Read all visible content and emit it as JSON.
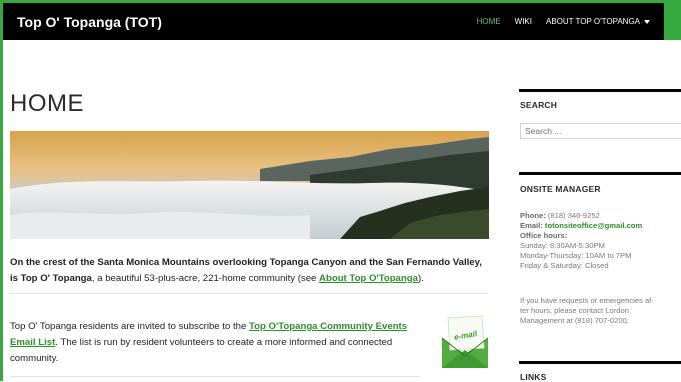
{
  "header": {
    "site_title": "Top O' Topanga (TOT)",
    "nav": [
      {
        "label": "HOME",
        "active": true
      },
      {
        "label": "WIKI",
        "active": false
      },
      {
        "label": "ABOUT TOP O'TOPANGA",
        "active": false,
        "has_dropdown": true
      }
    ]
  },
  "main": {
    "page_title": "HOME",
    "hero_image_icon": "landscape-photo",
    "intro": {
      "bold_text": "On the crest of the Santa Monica Mountains overlooking Topanga Canyon and the San Fernando Valley, is Top O' Topanga",
      "text": ", a beautiful 53-plus-acre, 221-home community (see ",
      "link": "About Top O'Topanga",
      "tail": ")."
    },
    "promo": {
      "text": "Top O' Topanga residents are invited to subscribe to the ",
      "link": "Top O'Topanga Community Events Email List",
      "tail": ". The list is run by resident volunteers to create a more informed and connected community."
    },
    "email_icon_label": "e-mail"
  },
  "sidebar": {
    "search": {
      "heading": "SEARCH",
      "placeholder": "Search ..."
    },
    "onsite": {
      "heading": "ONSITE MANAGER",
      "phone_label": "Phone:",
      "phone": "(818) 346-9252",
      "email_label": "Email:",
      "email": "totonsiteoffice@gmail.com",
      "hours_label": "Office hours:",
      "hours": [
        "Sunday: 8:30AM-5:30PM",
        "Monday-Thursday: 10AM to 7PM",
        "Friday & Saturday: Closed"
      ],
      "after_hours": [
        "If you have requests or emergencies af-",
        "ter hours, please contact Lordon",
        "Management at (818) 707-0200."
      ]
    },
    "links": {
      "heading": "LINKS"
    }
  },
  "colors": {
    "accent": "#36a93f",
    "link": "#2f8f2a",
    "topbar": "#000000"
  }
}
